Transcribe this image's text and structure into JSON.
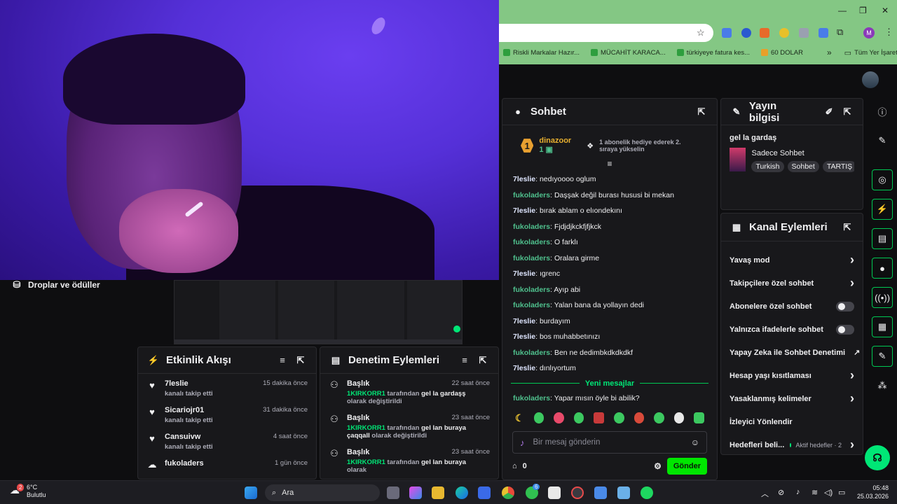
{
  "left_sidebar": {
    "drops_label": "Droplar ve ödüller"
  },
  "activity": {
    "title": "Etkinlik Akışı",
    "items": [
      {
        "name": "7leslie",
        "action": "kanalı takip etti",
        "time": "15 dakika önce"
      },
      {
        "name": "Sicariojr01",
        "action": "kanalı takip etti",
        "time": "31 dakika önce"
      },
      {
        "name": "Cansuivw",
        "action": "kanalı takip etti",
        "time": "4 saat önce"
      },
      {
        "name": "fukoladers",
        "action": "",
        "time": "1 gün önce"
      }
    ]
  },
  "moderation": {
    "title": "Denetim Eylemleri",
    "items": [
      {
        "title": "Başlık",
        "user": "1KIRKORR1",
        "mid": "tarafından",
        "value": "gel la gardaşş",
        "tail": "olarak değiştirildi",
        "time": "22 saat önce"
      },
      {
        "title": "Başlık",
        "user": "1KIRKORR1",
        "mid": "tarafından",
        "value": "gel lan buraya çaqqall",
        "tail": "olarak değiştirildi",
        "time": "23 saat önce"
      },
      {
        "title": "Başlık",
        "user": "1KIRKORR1",
        "mid": "tarafından",
        "value": "gel lan buraya",
        "tail": "olarak",
        "time": "23 saat önce"
      }
    ]
  },
  "browser": {
    "bookmarks": [
      "Riskli Markalar Hazır...",
      "MÜCAHİT KARACA...",
      "türkiyeye fatura kes...",
      "60 DOLAR"
    ],
    "all_bookmarks": "Tüm Yer İşaretleri",
    "more": "»",
    "profile_initial": "M"
  },
  "chat": {
    "title": "Sohbet",
    "pinned": {
      "rank": "1",
      "user": "dinazoor",
      "count": "1",
      "message": "1 abonelik hediye ederek 2. sıraya yükselin"
    },
    "messages": [
      {
        "user": "7leslie",
        "text": ": nedıyoooo oglum",
        "color": "#dfe6ff"
      },
      {
        "user": "fukoladers",
        "text": ": Daşşak değil burası hususi bi mekan",
        "color": "#4fc08d"
      },
      {
        "user": "7leslie",
        "text": ": bırak ablam o elıondekını",
        "color": "#dfe6ff"
      },
      {
        "user": "fukoladers",
        "text": ": Fjdjdjkckfjfjkck",
        "color": "#4fc08d"
      },
      {
        "user": "fukoladers",
        "text": ": O farklı",
        "color": "#4fc08d"
      },
      {
        "user": "fukoladers",
        "text": ": Oralara girme",
        "color": "#4fc08d"
      },
      {
        "user": "7leslie",
        "text": ": ıgrenc",
        "color": "#dfe6ff"
      },
      {
        "user": "fukoladers",
        "text": ": Ayıp abi",
        "color": "#4fc08d"
      },
      {
        "user": "fukoladers",
        "text": ": Yalan bana da yollayın dedi",
        "color": "#4fc08d"
      },
      {
        "user": "7leslie",
        "text": ": burdayım",
        "color": "#dfe6ff"
      },
      {
        "user": "7leslie",
        "text": ": bos muhabbetınızı",
        "color": "#dfe6ff"
      },
      {
        "user": "fukoladers",
        "text": ": Ben ne dedimbkdkdkdkf",
        "color": "#4fc08d"
      },
      {
        "user": "7leslie",
        "text": ": dınlıyortum",
        "color": "#dfe6ff"
      }
    ],
    "new_messages_label": "Yeni mesajlar",
    "new_message": {
      "user": "fukoladers",
      "text": ": Yapar mısın öyle bi abilik?"
    },
    "input_placeholder": "Bir mesaj gönderin",
    "points": "0",
    "send_label": "Gönder"
  },
  "stream_info": {
    "title": "Yayın bilgisi",
    "stream_title": "gel la gardaş",
    "category": "Sadece Sohbet",
    "tags": [
      "Turkish",
      "Sohbet",
      "TARTIŞ"
    ]
  },
  "channel_actions": {
    "title": "Kanal Eylemleri",
    "items": [
      {
        "label": "Yavaş mod",
        "control": "chevron"
      },
      {
        "label": "Takipçilere özel sohbet",
        "control": "chevron"
      },
      {
        "label": "Abonelere özel sohbet",
        "control": "toggle"
      },
      {
        "label": "Yalnızca ifadelerle sohbet",
        "control": "toggle"
      },
      {
        "label": "Yapay Zeka ile Sohbet Denetimi",
        "control": "external"
      },
      {
        "label": "Hesap yaşı kısıtlaması",
        "control": "chevron"
      },
      {
        "label": "Yasaklanmış kelimeler",
        "control": "chevron"
      },
      {
        "label": "İzleyici Yönlendir",
        "control": "none"
      },
      {
        "label": "Hedefleri beli...",
        "control": "chevron",
        "extra": "Aktif hedefler · 2"
      }
    ]
  },
  "taskbar": {
    "temp": "6°C",
    "weather": "Bulutlu",
    "search_label": "Ara",
    "time": "05:48",
    "date": "25.03.2026",
    "badge": "2",
    "whatsapp_badge": "6"
  },
  "colors": {
    "accent": "#00e676",
    "panel": "#18181b",
    "bg": "#0e0e10"
  }
}
